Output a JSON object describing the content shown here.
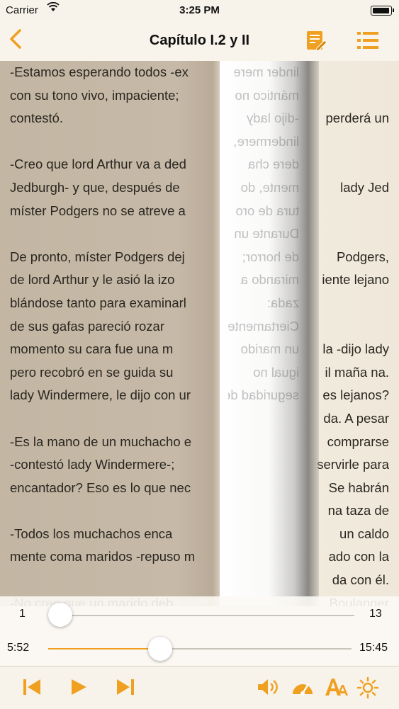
{
  "status_bar": {
    "carrier": "Carrier",
    "time": "3:25 PM"
  },
  "nav": {
    "title": "Capítulo I.2 y II"
  },
  "page_lines": [
    "-Estamos esperando todos -ex",
    "con su tono vivo, impaciente;",
    "contestó.",
    "",
    "-Creo que lord Arthur va a ded",
    "Jedburgh- y que, después de",
    "míster Podgers no se atreve a",
    "",
    "De pronto, míster Podgers dej",
    "de lord Arthur y le asió la izo",
    "blándose tanto para examinarl",
    "de sus gafas pareció rozar",
    "momento su cara fue una m",
    "pero recobró en se guida su",
    "lady Windermere, le dijo con ur",
    "",
    "-Es la mano de un muchacho e",
    "-contestó lady Windermere-;",
    "encantador? Eso es lo que nec",
    "",
    "-Todos los muchachos enca",
    "mente coma maridos -repuso m",
    "",
    "-No creo que un marido deb"
  ],
  "page_right_lines": [
    "",
    "",
    "perderá un",
    "",
    "",
    "lady Jed",
    "",
    "",
    "Podgers,",
    "iente lejano",
    "",
    "",
    "la -dijo lady",
    "il maña na.",
    "es lejanos?",
    "da. A pesar",
    "comprarse",
    "servirle para",
    "Se habrán",
    "na taza de",
    "un caldo",
    "ado con la",
    "da con él.",
    "Boulanger"
  ],
  "curl_mirror_lines": [
    "linder mere",
    "mántico no",
    "",
    "",
    "-dijo lady",
    "lindermere,",
    "",
    "",
    "dere cha",
    "mente, do",
    "tura de oro",
    "Durante un",
    "de horror;",
    "mirando a",
    "zada:",
    "",
    "Ciertamente",
    "un marido",
    "",
    "",
    "igual no",
    "",
    "",
    "seguridad de"
  ],
  "chapter_slider": {
    "min": "1",
    "max": "13",
    "value": 1,
    "range": [
      1,
      13
    ]
  },
  "time_slider": {
    "elapsed": "5:52",
    "total": "15:45",
    "progress": 0.37
  },
  "colors": {
    "accent": "#f0a020",
    "paper": "#efe9dc",
    "turned_page": "#c3b6a3"
  },
  "icons": [
    "back-chevron-icon",
    "edit-note-icon",
    "list-icon",
    "skip-previous-icon",
    "play-icon",
    "skip-next-icon",
    "volume-icon",
    "speed-gauge-icon",
    "font-size-icon",
    "brightness-icon"
  ]
}
